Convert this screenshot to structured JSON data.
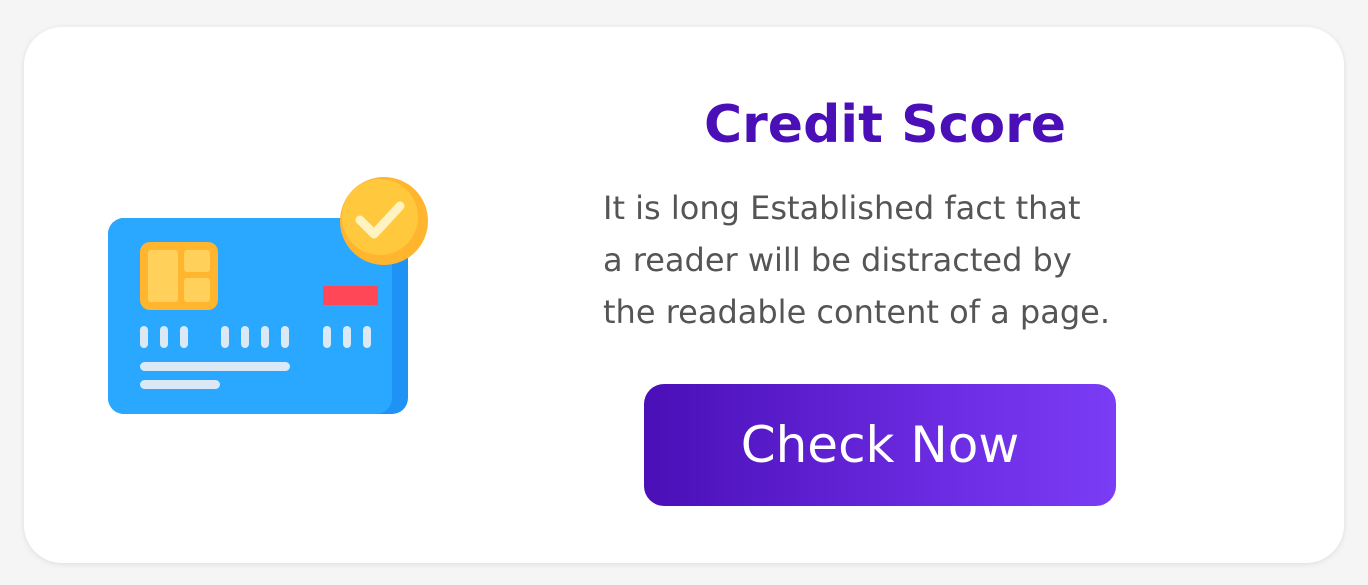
{
  "card": {
    "title": "Credit Score",
    "description_lines": [
      "It is long Established fact that",
      "a reader will be distracted by",
      "the readable content of a page."
    ],
    "cta_label": "Check Now"
  },
  "illustration": {
    "icon": "credit-card-icon",
    "badge_icon": "checkmark-icon"
  },
  "colors": {
    "title": "#4a0fb7",
    "body_text": "#555555",
    "button_gradient_start": "#4a0fb7",
    "button_gradient_end": "#7a3cf5",
    "card_blue": "#2aa8ff",
    "chip_yellow": "#ffcc4d",
    "badge_yellow": "#ffc83d",
    "stripe_red": "#ff4757"
  }
}
